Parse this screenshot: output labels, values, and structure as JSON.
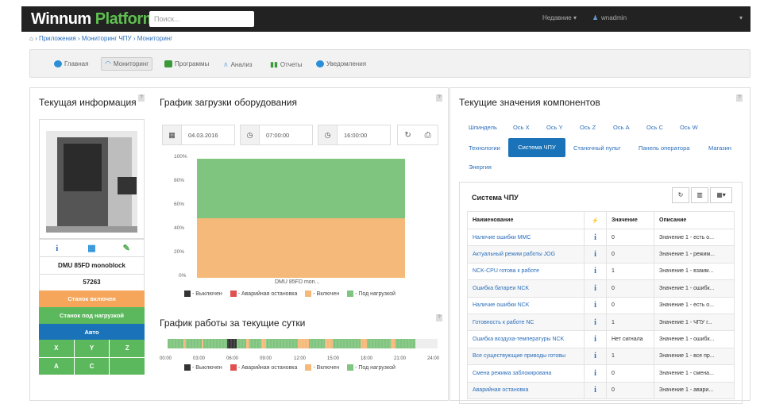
{
  "topbar": {
    "logo_main": "Winnum",
    "logo_accent": "Platform",
    "search_placeholder": "Поиск...",
    "recent": "Недавние ▾",
    "user": "wnadmin",
    "caret": "▾"
  },
  "breadcrumb": [
    "Приложения",
    "Мониторинг ЧПУ",
    "Мониторинг"
  ],
  "nav": [
    {
      "label": "Главная",
      "icon": "home-icon",
      "color": "#2a8fd8"
    },
    {
      "label": "Мониторинг",
      "icon": "gauge-icon",
      "color": "#2a8fd8"
    },
    {
      "label": "Программы",
      "icon": "program-icon",
      "color": "#3a9a3a"
    },
    {
      "label": "Анализ",
      "icon": "analysis-icon",
      "color": "#7ab0e0"
    },
    {
      "label": "Отчеты",
      "icon": "report-icon",
      "color": "#3a9a3a"
    },
    {
      "label": "Уведомления",
      "icon": "notify-icon",
      "color": "#2a8fd8"
    }
  ],
  "info": {
    "title": "Текущая информация",
    "model": "DMU 85FD monoblock",
    "serial": "57263",
    "status1": "Станок включен",
    "status2": "Станок под нагрузкой",
    "mode": "Авто",
    "axes": [
      "X",
      "Y",
      "Z",
      "A",
      "C"
    ],
    "icons": [
      "info-icon",
      "grid-icon",
      "leaf-icon"
    ],
    "icon_glyphs": [
      "i",
      "▦",
      "✎"
    ]
  },
  "load": {
    "title": "График загрузки оборудования",
    "date": "04.03.2016",
    "time_from": "07:00:00",
    "time_to": "16:00:00",
    "machine_label": "DMU 85FD mon...",
    "y_ticks": [
      "100%",
      "80%",
      "60%",
      "40%",
      "20%",
      "0%"
    ]
  },
  "chart_data": {
    "type": "bar",
    "categories": [
      "DMU 85FD mon..."
    ],
    "series": [
      {
        "name": "Выключен",
        "values": [
          0
        ],
        "color": "#333333"
      },
      {
        "name": "Аварийная остановка",
        "values": [
          0
        ],
        "color": "#e05050"
      },
      {
        "name": "Включен",
        "values": [
          50
        ],
        "color": "#f5b97a"
      },
      {
        "name": "Под нагрузкой",
        "values": [
          50
        ],
        "color": "#7fc47f"
      }
    ],
    "ylim": [
      0,
      100
    ],
    "stacked": true,
    "legend": "bottom"
  },
  "legend": [
    "- Выключен",
    "- Аварийная остановка",
    "- Включен",
    "- Под нагрузкой"
  ],
  "legend_colors": [
    "#333333",
    "#e05050",
    "#f5b97a",
    "#7fc47f"
  ],
  "daily": {
    "title": "График работы за текущие сутки",
    "ticks": [
      "00:00",
      "03:00",
      "06:00",
      "09:00",
      "12:00",
      "15:00",
      "18:00",
      "21:00",
      "24:00"
    ]
  },
  "components": {
    "title": "Текущие значения компонентов",
    "tabs_row1": [
      "Шпиндель",
      "Ось X",
      "Ось Y",
      "Ось Z",
      "Ось A",
      "Ось C",
      "Ось W"
    ],
    "tabs_row2": [
      "Технологии",
      "Система ЧПУ",
      "Станочный пульт",
      "Панель оператора",
      "Магазин"
    ],
    "tabs_row3": [
      "Энергия"
    ],
    "system_title": "Система ЧПУ",
    "columns": [
      "Наименование",
      "⚡",
      "Значение",
      "Описание"
    ],
    "rows": [
      [
        "Наличие ошибки ММС",
        "i",
        "0",
        "Значение 1 - есть о..."
      ],
      [
        "Актуальный режим работы JOG",
        "i",
        "0",
        "Значение 1 - режим..."
      ],
      [
        "NCK-CPU готова к работе",
        "i",
        "1",
        "Значение 1 - взаим..."
      ],
      [
        "Ошибка батареи NCK",
        "i",
        "0",
        "Значение 1 - ошибк..."
      ],
      [
        "Наличие ошибки NCK",
        "i",
        "0",
        "Значение 1 - есть о..."
      ],
      [
        "Готовность к работе NC",
        "i",
        "1",
        "Значение 1 - ЧПУ г..."
      ],
      [
        "Ошибка воздуха-температуры NCK",
        "i",
        "Нет сигнала",
        "Значение 1 - ошибк..."
      ],
      [
        "Все существующие приводы готовы",
        "i",
        "1",
        "Значение 1 - все пр..."
      ],
      [
        "Смена режима заблокирована",
        "i",
        "0",
        "Значение 1 - смена..."
      ],
      [
        "Аварийная остановка",
        "i",
        "0",
        "Значение 1 - авари..."
      ]
    ]
  }
}
